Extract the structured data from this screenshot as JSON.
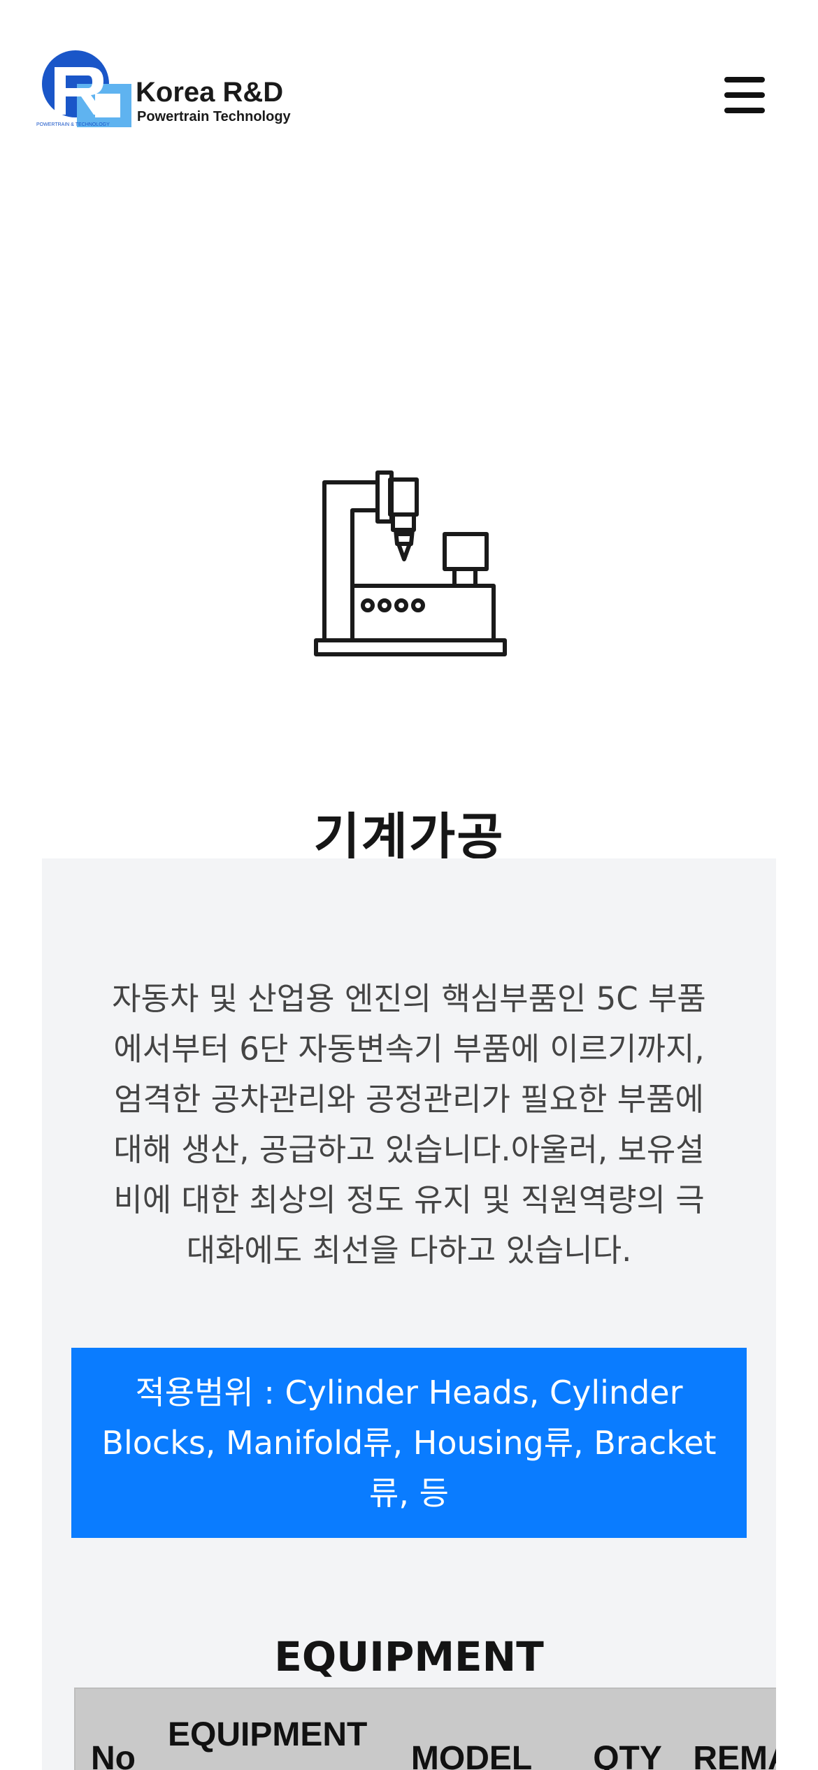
{
  "header": {
    "logo_title": "Korea R&D",
    "logo_subtitle": "Powertrain Technology",
    "logo_mark_text": "POWERTRAIN & TECHNOLOGY",
    "menu_icon": "hamburger-menu-icon"
  },
  "service": {
    "icon": "machining-center-icon",
    "title": "기계가공",
    "description": "자동차 및 산업용 엔진의 핵심부품인 5C 부품에서부터 6단 자동변속기 부품에 이르기까지,엄격한 공차관리와 공정관리가 필요한 부품에 대해 생산, 공급하고 있습니다.아울러, 보유설비에 대한 최상의 정도 유지 및 직원역량의 극대화에도 최선을 다하고 있습니다.",
    "scope": "적용범위 : Cylinder Heads, Cylinder Blocks, Manifold류, Housing류, Bracket류, 등"
  },
  "equipment": {
    "heading": "EQUIPMENT",
    "columns": {
      "no": "No",
      "equipment": "EQUIPMENT",
      "model": "MODEL",
      "qty": "QTY",
      "remark": "REMARK"
    }
  },
  "colors": {
    "accent_blue": "#0a7cff",
    "content_bg": "#f3f4f6",
    "table_header_bg": "#c9c9c9",
    "logo_blue": "#1a56c8",
    "logo_light_blue": "#5fb3f0"
  }
}
